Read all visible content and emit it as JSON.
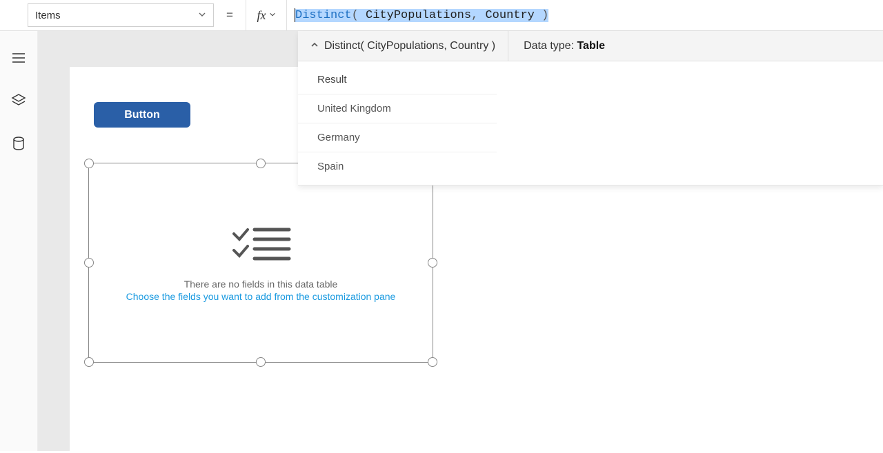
{
  "formulaBar": {
    "property": "Items",
    "equals": "=",
    "formula_tokens": {
      "kw": "Distinct",
      "open": "( ",
      "arg1": "CityPopulations",
      "comma": ", ",
      "arg2": "Country ",
      "close": ")"
    }
  },
  "intellisense": {
    "signature": "Distinct( CityPopulations, Country )",
    "dataTypeLabel": "Data type: ",
    "dataTypeValue": "Table",
    "columnHeader": "Result",
    "rows": [
      "United Kingdom",
      "Germany",
      "Spain"
    ]
  },
  "rail": {
    "icons": [
      "menu-icon",
      "layers-icon",
      "data-icon"
    ]
  },
  "canvas": {
    "button_label": "Button",
    "datatable": {
      "msg1": "There are no fields in this data table",
      "msg2": "Choose the fields you want to add from the customization pane"
    }
  }
}
